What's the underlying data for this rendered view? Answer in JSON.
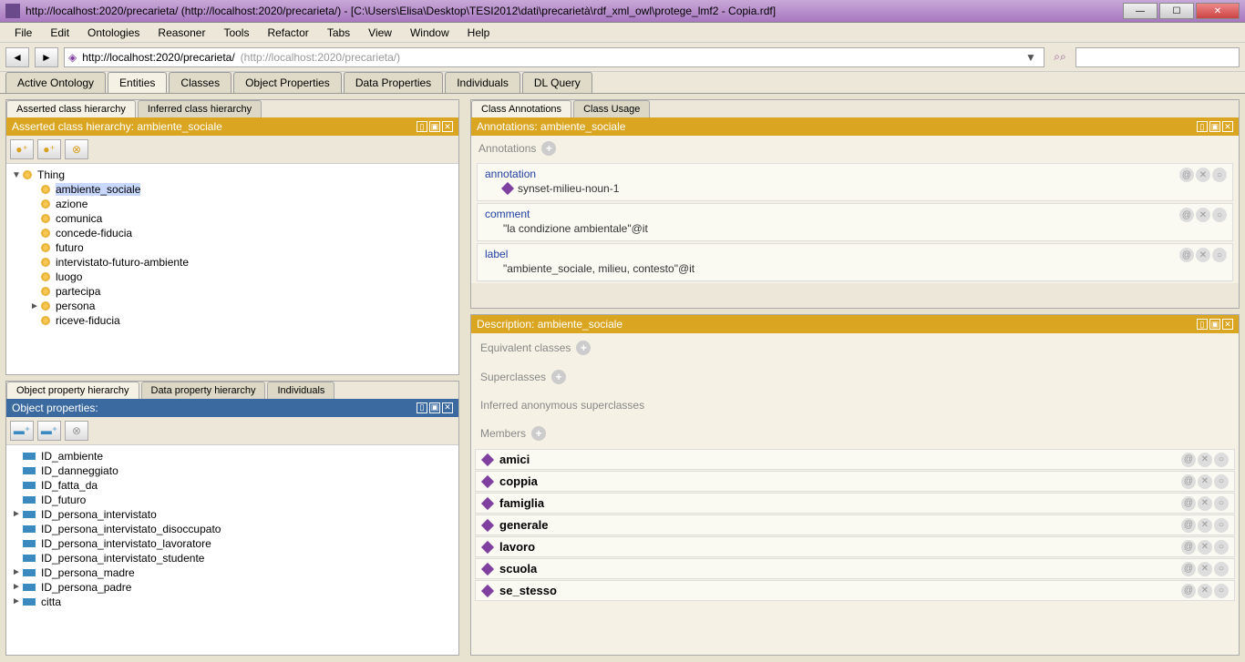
{
  "window": {
    "title": "http://localhost:2020/precarieta/ (http://localhost:2020/precarieta/) - [C:\\Users\\Elisa\\Desktop\\TESI2012\\dati\\precarietà\\rdf_xml_owl\\protege_lmf2 - Copia.rdf]",
    "minimize": "—",
    "maximize": "☐",
    "close": "✕"
  },
  "menu": [
    "File",
    "Edit",
    "Ontologies",
    "Reasoner",
    "Tools",
    "Refactor",
    "Tabs",
    "View",
    "Window",
    "Help"
  ],
  "toolbar": {
    "back": "◄",
    "forward": "►",
    "url_main": "http://localhost:2020/precarieta/",
    "url_paren": "(http://localhost:2020/precarieta/)"
  },
  "main_tabs": [
    "Active Ontology",
    "Entities",
    "Classes",
    "Object Properties",
    "Data Properties",
    "Individuals",
    "DL Query"
  ],
  "main_tabs_active": 1,
  "class_panel": {
    "tabs": [
      "Asserted class hierarchy",
      "Inferred class hierarchy"
    ],
    "tabs_active": 0,
    "header": "Asserted class hierarchy: ambiente_sociale",
    "root": "Thing",
    "items": [
      "ambiente_sociale",
      "azione",
      "comunica",
      "concede-fiducia",
      "futuro",
      "intervistato-futuro-ambiente",
      "luogo",
      "partecipa",
      "persona",
      "riceve-fiducia"
    ],
    "selected": 0,
    "expandable": [
      8
    ]
  },
  "obj_panel": {
    "tabs": [
      "Object property hierarchy",
      "Data property hierarchy",
      "Individuals"
    ],
    "tabs_active": 0,
    "header": "Object properties:",
    "items": [
      "ID_ambiente",
      "ID_danneggiato",
      "ID_fatta_da",
      "ID_futuro",
      "ID_persona_intervistato",
      "ID_persona_intervistato_disoccupato",
      "ID_persona_intervistato_lavoratore",
      "ID_persona_intervistato_studente",
      "ID_persona_madre",
      "ID_persona_padre",
      "citta"
    ],
    "expandable": [
      4,
      8,
      9,
      10
    ]
  },
  "anno_panel": {
    "tabs": [
      "Class Annotations",
      "Class Usage"
    ],
    "tabs_active": 0,
    "header": "Annotations: ambiente_sociale",
    "section_title": "Annotations",
    "items": [
      {
        "key": "annotation",
        "val": "synset-milieu-noun-1",
        "diamond": true
      },
      {
        "key": "comment",
        "val": "\"la condizione ambientale\"@it",
        "diamond": false
      },
      {
        "key": "label",
        "val": "\"ambiente_sociale, milieu, contesto\"@it",
        "diamond": false
      }
    ]
  },
  "desc_panel": {
    "header": "Description: ambiente_sociale",
    "sections": [
      "Equivalent classes",
      "Superclasses",
      "Inferred anonymous superclasses",
      "Members"
    ],
    "members": [
      "amici",
      "coppia",
      "famiglia",
      "generale",
      "lavoro",
      "scuola",
      "se_stesso"
    ]
  }
}
